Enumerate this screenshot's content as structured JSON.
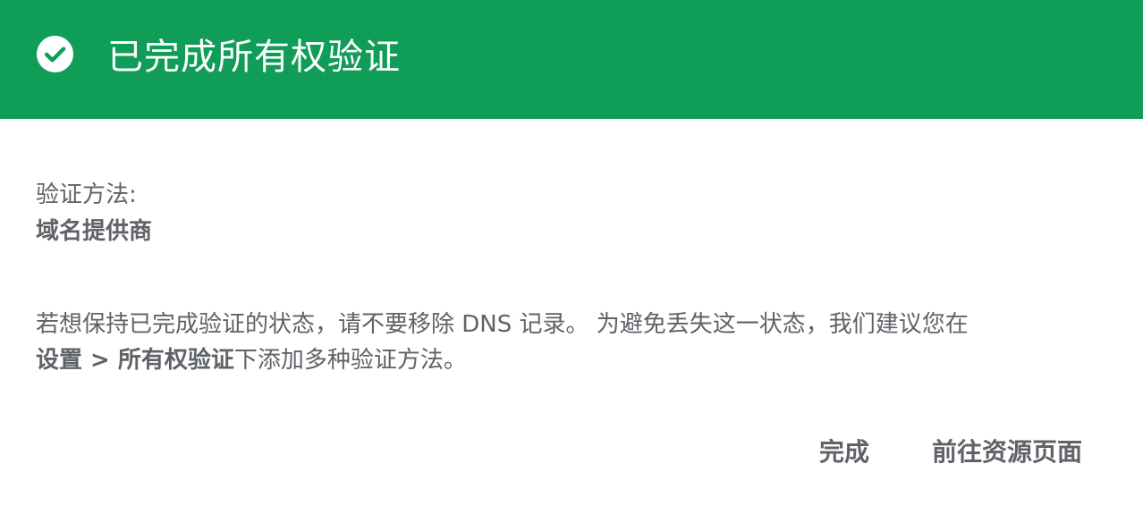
{
  "header": {
    "title": "已完成所有权验证",
    "icon": "check-circle-icon",
    "background_color": "#0f9d58"
  },
  "body": {
    "method_label": "验证方法:",
    "method_value": "域名提供商",
    "message_line1": "若想保持已完成验证的状态，请不要移除 DNS 记录。 为避免丢失这一状态，我们建议您在",
    "message_line2_bold": "设置 > 所有权验证",
    "message_line2_rest": "下添加多种验证方法。"
  },
  "actions": {
    "done_label": "完成",
    "go_to_property_label": "前往资源页面"
  }
}
